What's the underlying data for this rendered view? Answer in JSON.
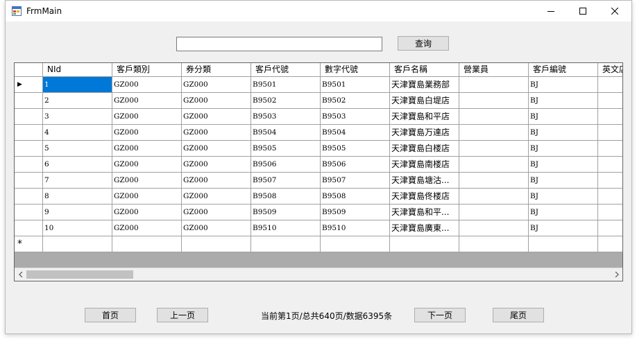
{
  "window": {
    "title": "FrmMain"
  },
  "search": {
    "value": "",
    "button_label": "查询"
  },
  "grid": {
    "columns": [
      "NId",
      "客戶類別",
      "券分類",
      "客戶代號",
      "數字代號",
      "客戶名稱",
      "營業員",
      "客戶編號",
      "英文店"
    ],
    "rows": [
      [
        "1",
        "GZ000",
        "GZ000",
        "B9501",
        "B9501",
        "天津寶島業務部",
        "",
        "BJ",
        ""
      ],
      [
        "2",
        "GZ000",
        "GZ000",
        "B9502",
        "B9502",
        "天津寶島白堤店",
        "",
        "BJ",
        ""
      ],
      [
        "3",
        "GZ000",
        "GZ000",
        "B9503",
        "B9503",
        "天津寶島和平店",
        "",
        "BJ",
        ""
      ],
      [
        "4",
        "GZ000",
        "GZ000",
        "B9504",
        "B9504",
        "天津寶島万達店",
        "",
        "BJ",
        ""
      ],
      [
        "5",
        "GZ000",
        "GZ000",
        "B9505",
        "B9505",
        "天津寶島白楼店",
        "",
        "BJ",
        ""
      ],
      [
        "6",
        "GZ000",
        "GZ000",
        "B9506",
        "B9506",
        "天津寶島南楼店",
        "",
        "BJ",
        ""
      ],
      [
        "7",
        "GZ000",
        "GZ000",
        "B9507",
        "B9507",
        "天津寶島塘沽...",
        "",
        "BJ",
        ""
      ],
      [
        "8",
        "GZ000",
        "GZ000",
        "B9508",
        "B9508",
        "天津寶島佟楼店",
        "",
        "BJ",
        ""
      ],
      [
        "9",
        "GZ000",
        "GZ000",
        "B9509",
        "B9509",
        "天津寶島和平...",
        "",
        "BJ",
        ""
      ],
      [
        "10",
        "GZ000",
        "GZ000",
        "B9510",
        "B9510",
        "天津寶島廣東...",
        "",
        "BJ",
        ""
      ]
    ],
    "new_row_marker": "*",
    "current_row_marker": "▶"
  },
  "pager": {
    "first_label": "首页",
    "prev_label": "上一页",
    "status": "当前第1页/总共640页/数据6395条",
    "next_label": "下一页",
    "last_label": "尾页"
  }
}
